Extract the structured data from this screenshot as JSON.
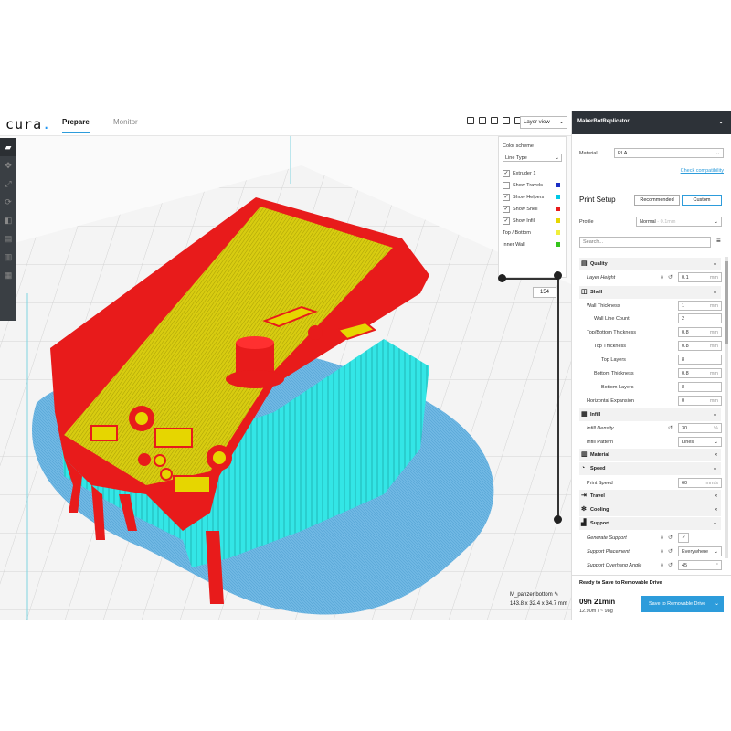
{
  "app": {
    "logo": "cura",
    "logo_dot": "."
  },
  "tabs": [
    {
      "label": "Prepare"
    },
    {
      "label": "Monitor"
    }
  ],
  "view_select": {
    "value": "Layer view"
  },
  "legend": {
    "color_scheme_label": "Color scheme",
    "color_scheme_value": "Line Type",
    "items": [
      {
        "label": "Extruder 1",
        "checked": true,
        "color": ""
      },
      {
        "label": "Show Travels",
        "checked": false,
        "color": "#1b2fc4"
      },
      {
        "label": "Show Helpers",
        "checked": true,
        "color": "#00c8e6"
      },
      {
        "label": "Show Shell",
        "checked": true,
        "color": "#e81b1b"
      },
      {
        "label": "Show Infill",
        "checked": true,
        "color": "#e6d600"
      },
      {
        "label": "Top / Bottom",
        "checked": null,
        "color": "#f0ef3b"
      },
      {
        "label": "Inner Wall",
        "checked": null,
        "color": "#34c41b"
      }
    ]
  },
  "layer": {
    "current": "154"
  },
  "model": {
    "name": "M_panzer bottom",
    "dimensions": "143.8 x 32.4 x 34.7 mm"
  },
  "panel": {
    "machine": "MakerBotReplicator",
    "material_label": "Material",
    "material_value": "PLA",
    "check_compat": "Check compatibility",
    "print_setup": "Print Setup",
    "mode_recommended": "Recommended",
    "mode_custom": "Custom",
    "profile_label": "Profile",
    "profile_value": "Normal",
    "profile_hint": "- 0.1mm",
    "search_placeholder": "Search...",
    "categories": {
      "quality": "Quality",
      "shell": "Shell",
      "infill": "Infill",
      "material": "Material",
      "speed": "Speed",
      "travel": "Travel",
      "cooling": "Cooling",
      "support": "Support"
    },
    "settings": {
      "layer_height": {
        "label": "Layer Height",
        "value": "0.1",
        "unit": "mm"
      },
      "wall_thickness": {
        "label": "Wall Thickness",
        "value": "1",
        "unit": "mm"
      },
      "wall_line_count": {
        "label": "Wall Line Count",
        "value": "2",
        "unit": ""
      },
      "top_bottom_thickness": {
        "label": "Top/Bottom Thickness",
        "value": "0.8",
        "unit": "mm"
      },
      "top_thickness": {
        "label": "Top Thickness",
        "value": "0.8",
        "unit": "mm"
      },
      "top_layers": {
        "label": "Top Layers",
        "value": "8",
        "unit": ""
      },
      "bottom_thickness": {
        "label": "Bottom Thickness",
        "value": "0.8",
        "unit": "mm"
      },
      "bottom_layers": {
        "label": "Bottom Layers",
        "value": "8",
        "unit": ""
      },
      "horizontal_expansion": {
        "label": "Horizontal Expansion",
        "value": "0",
        "unit": "mm"
      },
      "infill_density": {
        "label": "Infill Density",
        "value": "30",
        "unit": "%"
      },
      "infill_pattern": {
        "label": "Infill Pattern",
        "value": "Lines",
        "unit": ""
      },
      "print_speed": {
        "label": "Print Speed",
        "value": "60",
        "unit": "mm/s"
      },
      "generate_support": {
        "label": "Generate Support",
        "value": "✓",
        "unit": ""
      },
      "support_placement": {
        "label": "Support Placement",
        "value": "Everywhere",
        "unit": ""
      },
      "support_overhang": {
        "label": "Support Overhang Angle",
        "value": "45",
        "unit": "°"
      }
    },
    "footer": {
      "ready": "Ready to Save to Removable Drive",
      "time": "09h 21min",
      "material_amount": "12.90m / ~ 98g",
      "save_button": "Save to Removable Drive"
    }
  }
}
